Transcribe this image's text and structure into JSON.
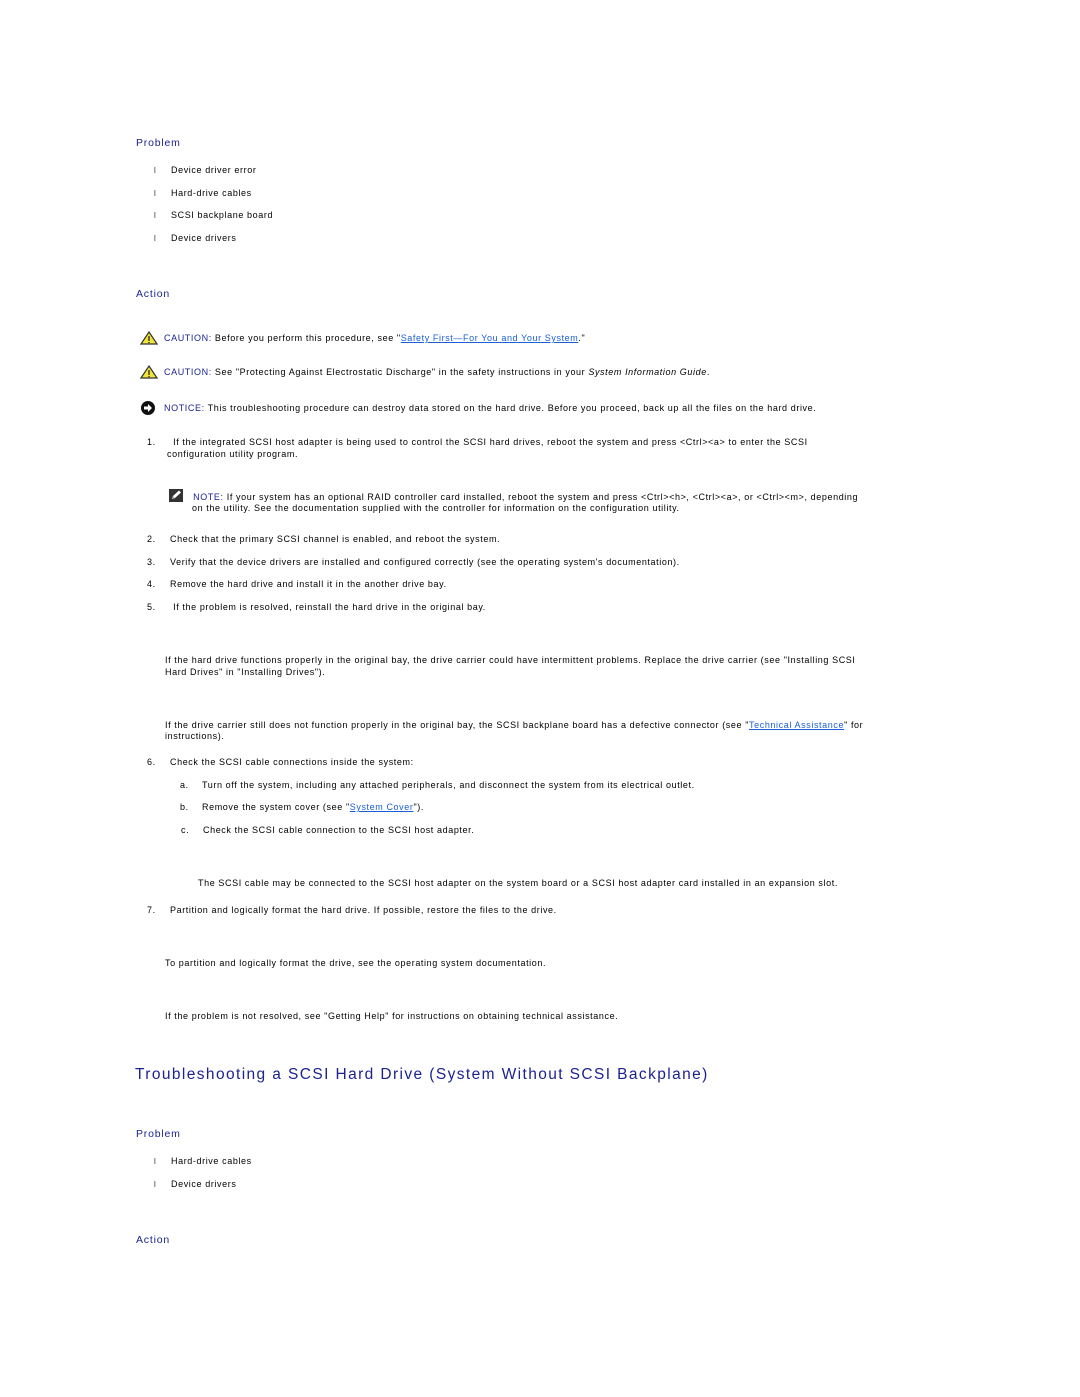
{
  "section1": {
    "problem_heading": "Problem",
    "problems": [
      "Device driver error",
      "Hard-drive cables",
      "SCSI backplane board",
      "Device drivers"
    ],
    "bullet_glyph": "l",
    "action_heading": "Action",
    "caution1": {
      "label": "CAUTION:",
      "text_before": " Before you perform this procedure, see \"",
      "link": "Safety First—For You and Your System",
      "text_after": ".\""
    },
    "caution2": {
      "label": "CAUTION:",
      "text_before": " See \"Protecting Against Electrostatic Discharge\" in the safety instructions in your ",
      "emph": "System Information Guide",
      "text_after": "."
    },
    "notice": {
      "label": "NOTICE:",
      "text": " This troubleshooting procedure can destroy data stored on the hard drive. Before you proceed, back up all the files on the hard drive."
    },
    "steps": {
      "s1_num": "1.",
      "s1_line1": " If the integrated SCSI host adapter is being used to control the SCSI hard drives, reboot the system and press <Ctrl><a> to enter the SCSI",
      "s1_line2": "configuration utility program.",
      "note_label": "NOTE:",
      "note_line1": " If your system has an optional RAID controller card installed, reboot the system and press <Ctrl><h>, <Ctrl><a>, or <Ctrl><m>, depending",
      "note_line2": "on the utility. See the documentation supplied with the controller for information on the configuration utility.",
      "s2_num": "2.",
      "s2": "Check that the primary SCSI channel is enabled, and reboot the system.",
      "s3_num": "3.",
      "s3": "Verify that the device drivers are installed and configured correctly (see the operating system's documentation).",
      "s4_num": "4.",
      "s4": "Remove the hard drive and install it in the another drive bay.",
      "s5_num": "5.",
      "s5": " If the problem is resolved, reinstall the hard drive in the original bay.",
      "p_carrier_line1": "If the hard drive functions properly in the original bay, the drive carrier could have intermittent problems. Replace the drive carrier (see \"Installing SCSI",
      "p_carrier_line2": "Hard Drives\" in \"Installing Drives\").",
      "p_backplane_before": "If the drive carrier still does not function properly in the original bay, the SCSI backplane board has a defective connector (see \"",
      "p_backplane_link": "Technical Assistance",
      "p_backplane_after": "\" for",
      "p_backplane_line2": "instructions).",
      "s6_num": "6.",
      "s6": "Check the SCSI cable connections inside the system:",
      "s6a_num": "a.",
      "s6a": "Turn off the system, including any attached peripherals, and disconnect the system from its electrical outlet.",
      "s6b_num": "b.",
      "s6b_before": "Remove the system cover (see \"",
      "s6b_link": "System Cover",
      "s6b_after": "\").",
      "s6c_num": "c.",
      "s6c": "Check the SCSI cable connection to the SCSI host adapter.",
      "p_cable": "The SCSI cable may be connected to the SCSI host adapter on the system board or a SCSI host adapter card installed in an expansion slot.",
      "s7_num": "7.",
      "s7": "Partition and logically format the hard drive. If possible, restore the files to the drive.",
      "p_partition": "To partition and logically format the drive, see the operating system documentation.",
      "p_help": "If the problem is not resolved, see \"Getting Help\" for instructions on obtaining technical assistance."
    }
  },
  "section2": {
    "title": "Troubleshooting a SCSI Hard Drive (System Without SCSI Backplane)",
    "problem_heading": "Problem",
    "problems": [
      "Hard-drive cables",
      "Device drivers"
    ],
    "action_heading": "Action"
  },
  "icons": {
    "caution": "warning-triangle-icon",
    "notice": "notice-arrow-icon",
    "note": "pencil-note-icon"
  }
}
